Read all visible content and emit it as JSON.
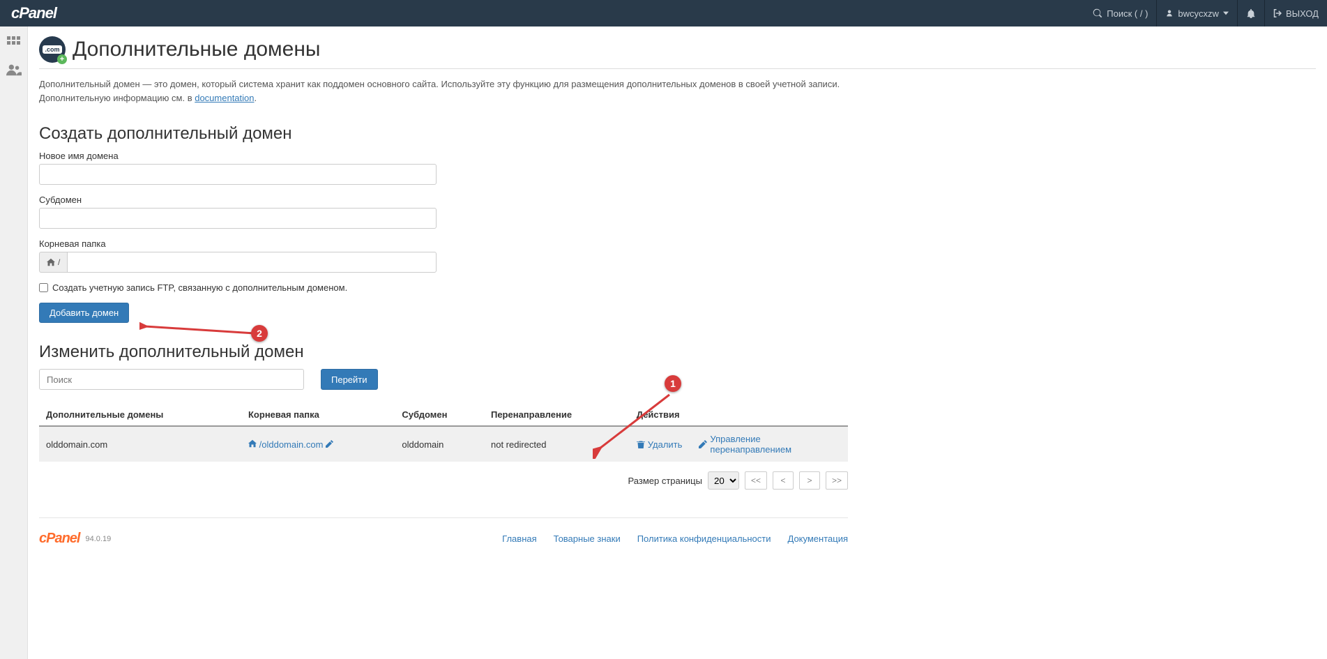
{
  "header": {
    "logo": "cPanel",
    "search_label": "Поиск ( / )",
    "user": "bwcycxzw",
    "logout": "ВЫХОД"
  },
  "page": {
    "icon_text": ".com",
    "title": "Дополнительные домены",
    "desc_pre": "Дополнительный домен — это домен, который система хранит как поддомен основного сайта. Используйте эту функцию для размещения дополнительных доменов в своей учетной записи. Дополнительную информацию см. в ",
    "desc_link": "documentation",
    "desc_post": "."
  },
  "create": {
    "heading": "Создать дополнительный домен",
    "new_domain_label": "Новое имя домена",
    "subdomain_label": "Субдомен",
    "root_label": "Корневая папка",
    "root_prefix": "/",
    "ftp_checkbox": "Создать учетную запись FTP, связанную с дополнительным доменом.",
    "submit": "Добавить домен"
  },
  "modify": {
    "heading": "Изменить дополнительный домен",
    "search_placeholder": "Поиск",
    "go": "Перейти",
    "columns": {
      "addon": "Дополнительные домены",
      "root": "Корневая папка",
      "sub": "Субдомен",
      "redirect": "Перенаправление",
      "actions": "Действия"
    },
    "row": {
      "domain": "olddomain.com",
      "root": "/olddomain.com",
      "sub": "olddomain",
      "redirect": "not redirected",
      "delete": "Удалить",
      "manage": "Управление перенаправлением"
    }
  },
  "pager": {
    "label": "Размер страницы",
    "size": "20",
    "first": "<<",
    "prev": "<",
    "next": ">",
    "last": ">>"
  },
  "footer": {
    "logo": "cPanel",
    "version": "94.0.19",
    "home": "Главная",
    "trademarks": "Товарные знаки",
    "privacy": "Политика конфиденциальности",
    "docs": "Документация"
  },
  "anno": {
    "n1": "1",
    "n2": "2"
  }
}
